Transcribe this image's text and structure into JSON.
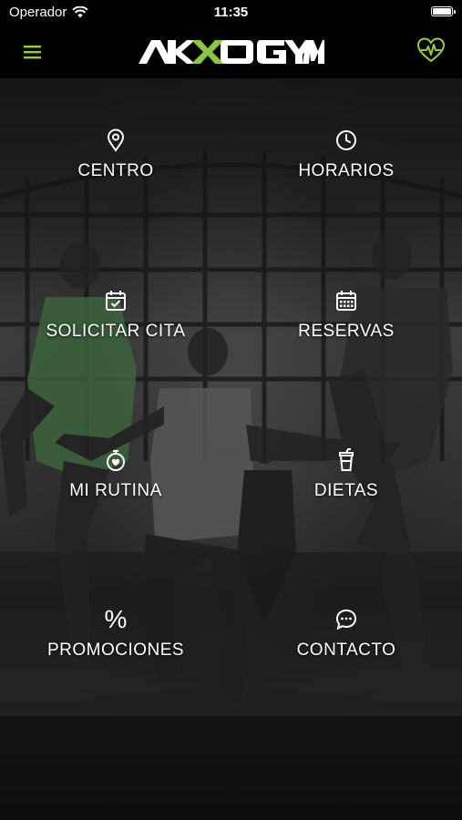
{
  "status_bar": {
    "carrier": "Operador",
    "time": "11:35"
  },
  "header": {
    "logo_text": "AKOGYM",
    "menu_icon": "hamburger-menu-icon",
    "right_icon": "heart-pulse-icon",
    "accent_color": "#9acd32"
  },
  "menu": {
    "items": [
      {
        "label": "CENTRO",
        "icon": "location-pin-icon"
      },
      {
        "label": "HORARIOS",
        "icon": "clock-icon"
      },
      {
        "label": "SOLICITAR CITA",
        "icon": "calendar-check-icon"
      },
      {
        "label": "RESERVAS",
        "icon": "calendar-grid-icon"
      },
      {
        "label": "MI RUTINA",
        "icon": "stopwatch-heart-icon"
      },
      {
        "label": "DIETAS",
        "icon": "drink-cup-icon"
      },
      {
        "label": "PROMOCIONES",
        "icon": "percent-icon",
        "icon_text": "%"
      },
      {
        "label": "CONTACTO",
        "icon": "chat-bubble-icon"
      }
    ]
  }
}
